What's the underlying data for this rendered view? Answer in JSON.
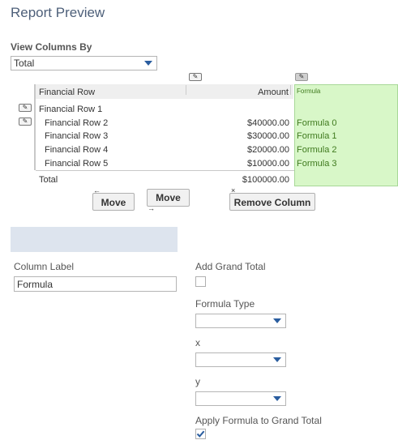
{
  "page_title": "Report Preview",
  "view_columns": {
    "label": "View Columns By",
    "selected": "Total"
  },
  "grid": {
    "header_financial_row": "Financial Row",
    "header_amount": "Amount",
    "header_formula": "Formula",
    "rows": [
      {
        "label": "Financial Row 1",
        "amount": "",
        "formula": ""
      },
      {
        "label": "Financial Row 2",
        "amount": "$40000.00",
        "formula": "Formula 0"
      },
      {
        "label": "Financial Row 3",
        "amount": "$30000.00",
        "formula": "Formula 1"
      },
      {
        "label": "Financial Row 4",
        "amount": "$20000.00",
        "formula": "Formula 2"
      },
      {
        "label": "Financial Row 5",
        "amount": "$10000.00",
        "formula": "Formula 3"
      }
    ],
    "total_label": "Total",
    "total_amount": "$100000.00"
  },
  "buttons": {
    "move_left": "Move",
    "move_right": "Move",
    "remove_column": "Remove Column"
  },
  "form": {
    "column_label_label": "Column Label",
    "column_label_value": "Formula",
    "add_grand_total_label": "Add Grand Total",
    "add_grand_total_checked": false,
    "formula_type_label": "Formula Type",
    "formula_type_value": "",
    "x_label": "x",
    "x_value": "",
    "y_label": "y",
    "y_value": "",
    "apply_formula_label": "Apply Formula to Grand Total",
    "apply_formula_checked": true
  },
  "colors": {
    "title": "#4d5f79",
    "formula_bg": "#d8f7c8",
    "formula_text": "#3f7a1e",
    "accent": "#2a5d9f",
    "panel": "#dde4ee"
  },
  "icons": {
    "edit": "pencil-icon",
    "move_left": "arrow-left-icon",
    "move_right": "arrow-right-icon",
    "remove": "close-icon",
    "dropdown": "chevron-down-icon",
    "check": "checkmark-icon"
  }
}
